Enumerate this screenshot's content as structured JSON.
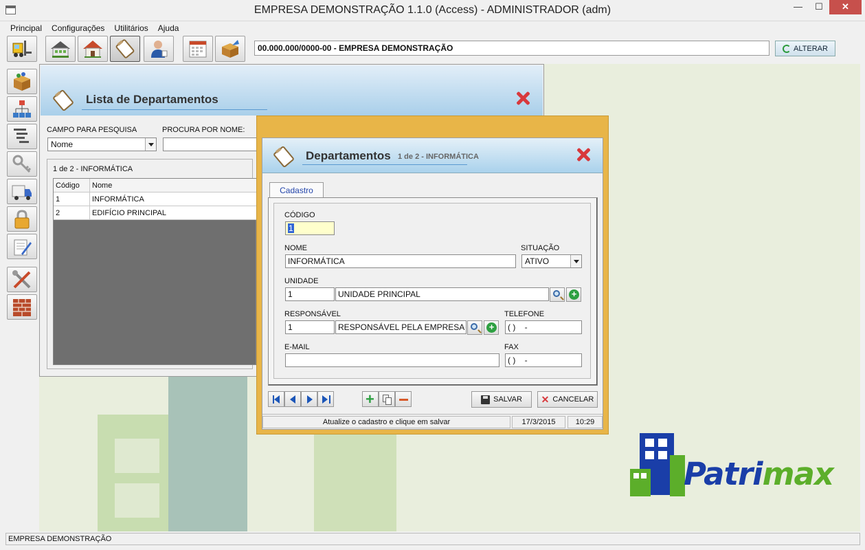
{
  "window": {
    "title": "EMPRESA DEMONSTRAÇÃO 1.1.0 (Access) - ADMINISTRADOR (adm)",
    "min_label": "—",
    "max_label": "☐",
    "close_label": "✕"
  },
  "menu": [
    "Principal",
    "Configurações",
    "Utilitários",
    "Ajuda"
  ],
  "toolbar": {
    "company": "00.000.000/0000-00 - EMPRESA DEMONSTRAÇÃO",
    "alterar_label": "ALTERAR"
  },
  "lista": {
    "title": "Lista de Departamentos",
    "campo_label": "CAMPO PARA PESQUISA",
    "campo_value": "Nome",
    "procura_label": "PROCURA POR NOME:",
    "procura_value": "",
    "count": "1 de 2 - INFORMÁTICA",
    "columns": [
      "Código",
      "Nome"
    ],
    "rows": [
      {
        "codigo": "1",
        "nome": "INFORMÁTICA"
      },
      {
        "codigo": "2",
        "nome": "EDIFÍCIO PRINCIPAL"
      }
    ]
  },
  "dept": {
    "title": "Departamentos",
    "subtitle": "1 de 2 - INFORMÁTICA",
    "tab": "Cadastro",
    "codigo_label": "CÓDIGO",
    "codigo_value": "1",
    "nome_label": "NOME",
    "nome_value": "INFORMÁTICA",
    "situacao_label": "SITUAÇÃO",
    "situacao_value": "ATIVO",
    "unidade_label": "UNIDADE",
    "unidade_code": "1",
    "unidade_name": "UNIDADE PRINCIPAL",
    "responsavel_label": "RESPONSÁVEL",
    "responsavel_code": "1",
    "responsavel_name": "RESPONSÁVEL PELA EMPRESA",
    "telefone_label": "TELEFONE",
    "telefone_value": "( )    -",
    "email_label": "E-MAIL",
    "email_value": "",
    "fax_label": "FAX",
    "fax_value": "( )    -",
    "salvar_label": "SALVAR",
    "cancelar_label": "CANCELAR",
    "status_msg": "Atualize o cadastro e clique em salvar",
    "status_date": "17/3/2015",
    "status_time": "10:29"
  },
  "logo": {
    "text_a": "Patri",
    "text_b": "max"
  },
  "status": {
    "company": "EMPRESA DEMONSTRAÇÃO"
  },
  "colors": {
    "accent": "#1c56b8",
    "dialog_frame": "#e8b548",
    "close": "#d8383c",
    "logo_blue": "#1a3ea8",
    "logo_green": "#5cae2a"
  }
}
